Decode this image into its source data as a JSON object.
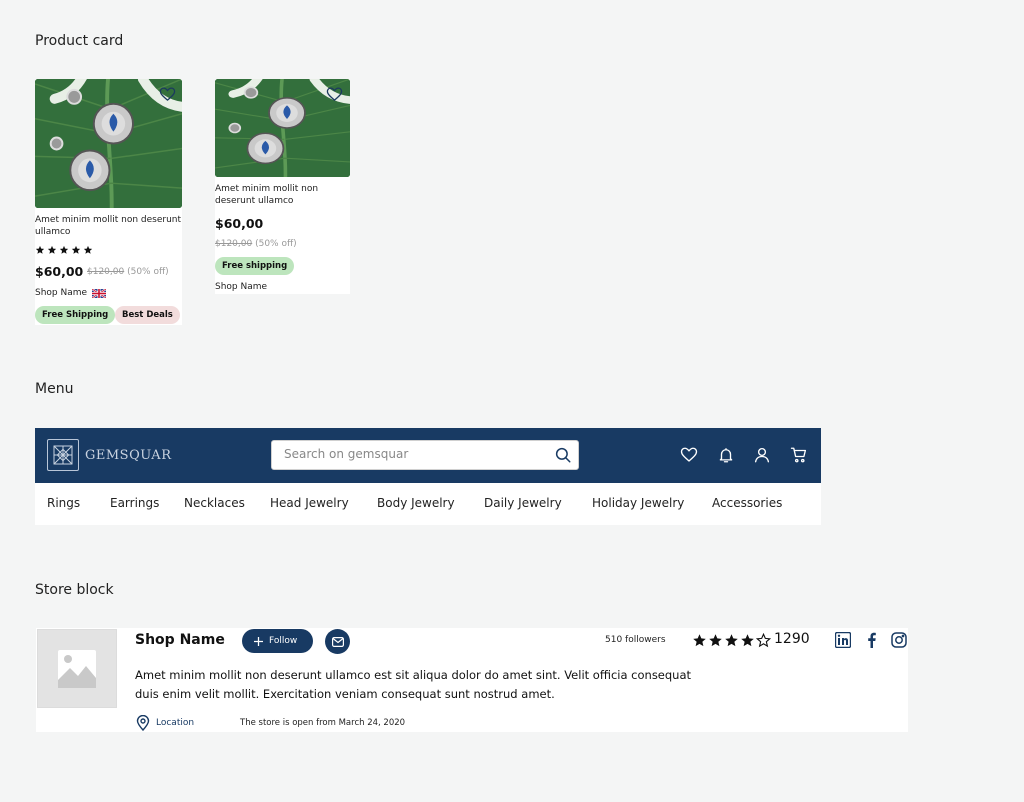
{
  "sections": {
    "product_card": "Product card",
    "menu": "Menu",
    "store_block": "Store block"
  },
  "card1": {
    "title": "Amet minim mollit non deserunt ullamco",
    "rating_stars": 5,
    "price": "$60,00",
    "old_price": "$120,00",
    "discount": "(50% off)",
    "shop": "Shop Name",
    "badges": [
      "Free Shipping",
      "Best Deals"
    ]
  },
  "card2": {
    "title": "Amet minim mollit non deserunt ullamco",
    "price": "$60,00",
    "old_price": "$120,00",
    "discount": "(50% off)",
    "badge": "Free shipping",
    "shop": "Shop Name"
  },
  "menu": {
    "logo_text": "GEMSQUAR",
    "search_placeholder": "Search on gemsquar",
    "icons": [
      "heart-icon",
      "bell-icon",
      "user-icon",
      "cart-icon"
    ],
    "categories": [
      "Rings",
      "Earrings",
      "Necklaces",
      "Head Jewelry",
      "Body Jewelry",
      "Daily Jewelry",
      "Holiday Jewelry",
      "Accessories"
    ]
  },
  "store": {
    "name": "Shop Name",
    "follow_label": "Follow",
    "followers": "510 followers",
    "rating_stars": 4,
    "rating_count": "1290",
    "description": "Amet minim mollit non deserunt ullamco est sit aliqua dolor do amet sint. Velit officia consequat duis enim velit mollit. Exercitation veniam consequat sunt nostrud amet.",
    "location_label": "Location",
    "opened_text": "The store is open from March 24, 2020",
    "social": [
      "linkedin-icon",
      "facebook-icon",
      "instagram-icon"
    ]
  },
  "colors": {
    "navy": "#183a63",
    "green_badge": "#bde5bd",
    "pink_badge": "#f2dcdc",
    "background": "#f4f5f5"
  }
}
